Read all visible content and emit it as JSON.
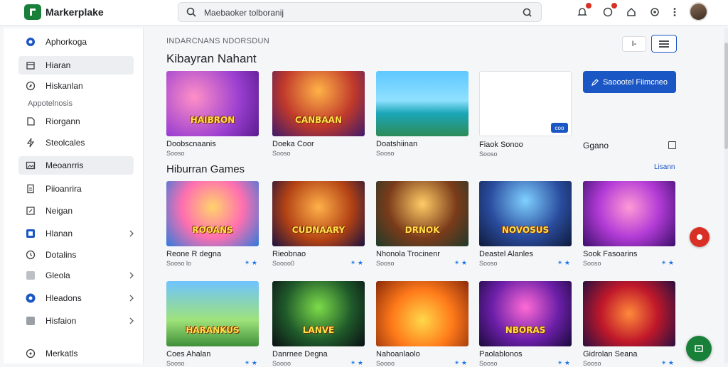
{
  "header": {
    "brand": "Markerplake",
    "search_text": "Maebaoker tolboranij",
    "icons": [
      "search-icon",
      "camera-icon",
      "notification-icon",
      "chat-icon",
      "home-icon",
      "settings-icon",
      "more-icon"
    ]
  },
  "sidebar": {
    "items": [
      {
        "label": "Aphorkoga",
        "icon": "globe-icon",
        "active": false
      },
      {
        "label": "Hiaran",
        "icon": "gift-icon",
        "active": true
      },
      {
        "label": "Hiskanlan",
        "icon": "compass-icon",
        "active": false
      }
    ],
    "section_label": "Appotelnosis",
    "apps": [
      {
        "label": "Riorgann",
        "icon": "file-icon"
      },
      {
        "label": "Steolcales",
        "icon": "bolt-icon"
      },
      {
        "label": "Meoanrris",
        "icon": "image-icon",
        "highlight": true
      },
      {
        "label": "Piioanrira",
        "icon": "doc-icon"
      },
      {
        "label": "Neigan",
        "icon": "shield-icon"
      },
      {
        "label": "Hlanan",
        "icon": "square-icon",
        "chevron": true
      },
      {
        "label": "Dotalins",
        "icon": "clock-icon"
      },
      {
        "label": "Gleola",
        "icon": "grid-icon",
        "chevron": true
      },
      {
        "label": "Hleadons",
        "icon": "circle-icon",
        "chevron": true
      },
      {
        "label": "Hisfaion",
        "icon": "box-icon",
        "chevron": true
      }
    ],
    "footer_item": {
      "label": "Merkatls",
      "icon": "info-icon"
    }
  },
  "main": {
    "breadcrumb": "INDARCNANS NDORSDUN",
    "title": "Kibayran Nahant",
    "sort_label": "I-",
    "featured": [
      {
        "name": "Doobscnaanis",
        "meta": "Sooso",
        "thumb_title": "HAIBRON"
      },
      {
        "name": "Doeka Coor",
        "meta": "Sooso",
        "thumb_title": "CANBAAN"
      },
      {
        "name": "Doatshiinan",
        "meta": "Sooso",
        "thumb_title": ""
      }
    ],
    "blank_card": {
      "name": "Fiaok Sonoo",
      "meta": "Sooso",
      "tag": "coo"
    },
    "cta_label": "Saoootel Fiimcneo",
    "side_label": "Ggano",
    "section2": "Hiburran Games",
    "see_all": "Lisann",
    "row2": [
      {
        "name": "Reone R degna",
        "meta": "Sooso lo",
        "rating": "✴ ★",
        "thumb_title": "ROOANS"
      },
      {
        "name": "Rieobnao",
        "meta": "Soooo0",
        "rating": "✴ ★",
        "thumb_title": "CUDNAARY"
      },
      {
        "name": "Nhonola Trocinenr",
        "meta": "Sooso",
        "rating": "✴ ★",
        "thumb_title": "DRNOK"
      },
      {
        "name": "Deastel Alanles",
        "meta": "Sooso",
        "rating": "✴ ★",
        "thumb_title": "NOVOSUS"
      },
      {
        "name": "Sook Fasoarins",
        "meta": "Sooso",
        "rating": "✴ ★",
        "thumb_title": ""
      }
    ],
    "row3": [
      {
        "name": "Coes Ahalan",
        "meta": "Sooso",
        "rating": "✴ ★",
        "thumb_title": "HARANKUS"
      },
      {
        "name": "Danrnee Degna",
        "meta": "Soooo",
        "rating": "✴ ★",
        "thumb_title": "LANVE"
      },
      {
        "name": "Nahoanlaolo",
        "meta": "Soooo",
        "rating": "✴ ★",
        "thumb_title": ""
      },
      {
        "name": "Paolablonos",
        "meta": "Sooso",
        "rating": "✴ ★",
        "thumb_title": "NBORAS"
      },
      {
        "name": "Gidrolan Seana",
        "meta": "Sooso",
        "rating": "✴ ★",
        "thumb_title": ""
      }
    ]
  },
  "colors": {
    "accent": "#1a56c4",
    "brand": "#188038",
    "alert": "#d93025"
  }
}
